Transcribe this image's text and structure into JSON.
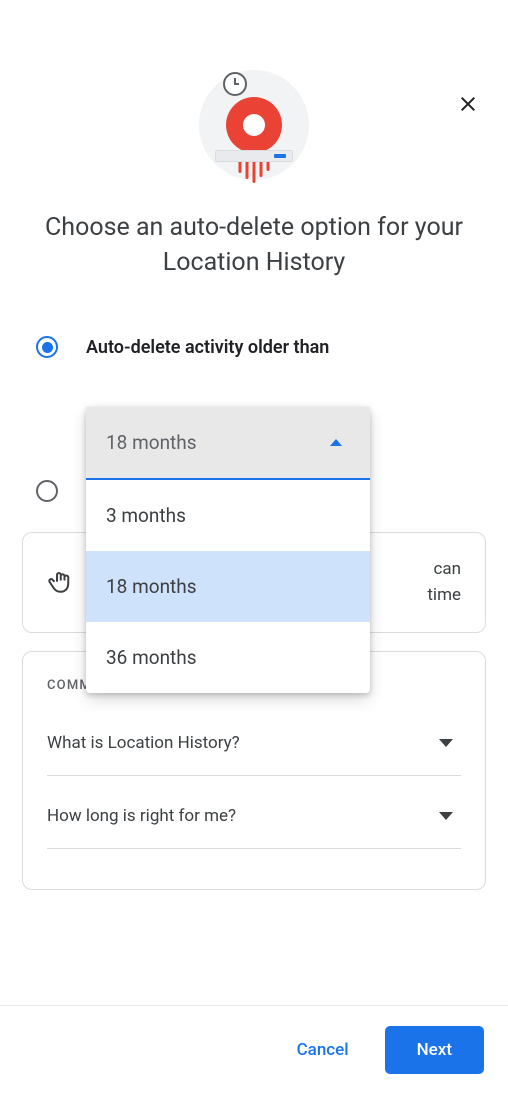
{
  "title": "Choose an auto-delete option for your Location History",
  "options": {
    "auto_delete_label": "Auto-delete activity older than",
    "dropdown": {
      "selected": "18 months",
      "items": [
        "3 months",
        "18 months",
        "36 months"
      ],
      "highlighted_index": 1
    }
  },
  "note": {
    "text_visible_right": "can",
    "text_visible_right2": "time"
  },
  "questions": {
    "heading": "COMMON QUESTIONS",
    "items": [
      "What is Location History?",
      "How long is right for me?"
    ]
  },
  "footer": {
    "cancel": "Cancel",
    "next": "Next"
  }
}
